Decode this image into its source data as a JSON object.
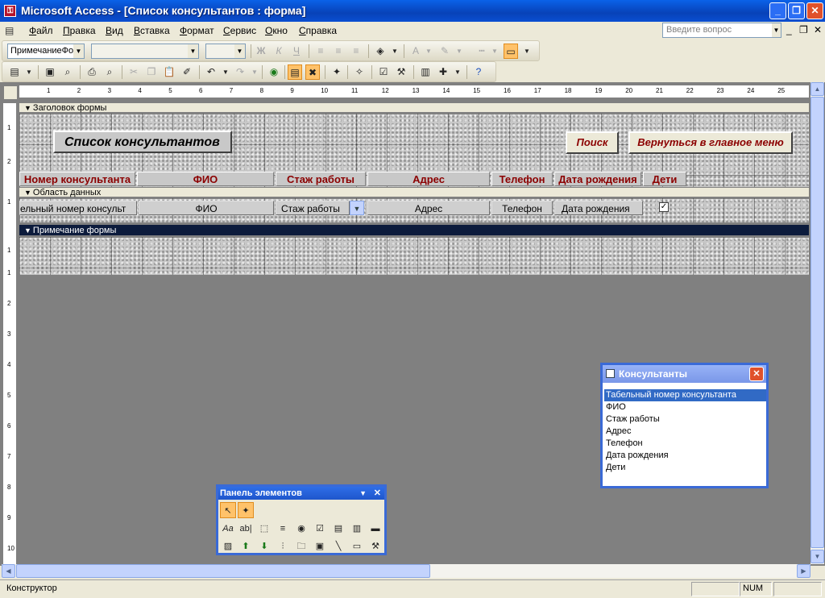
{
  "window": {
    "title": "Microsoft Access - [Список консультантов : форма]",
    "app_icon": "key-icon",
    "minimize": "_",
    "restore": "❐",
    "close": "✕"
  },
  "menu": {
    "icon": "form-icon",
    "items": [
      {
        "label": "Файл",
        "u": "Ф",
        "rest": "айл"
      },
      {
        "label": "Правка",
        "u": "П",
        "rest": "равка"
      },
      {
        "label": "Вид",
        "u": "В",
        "rest": "ид"
      },
      {
        "label": "Вставка",
        "u": "В",
        "rest": "ставка"
      },
      {
        "label": "Формат",
        "u": "Ф",
        "rest": "ормат"
      },
      {
        "label": "Сервис",
        "u": "С",
        "rest": "ервис"
      },
      {
        "label": "Окно",
        "u": "О",
        "rest": "кно"
      },
      {
        "label": "Справка",
        "u": "С",
        "rest": "правка"
      }
    ],
    "ask_placeholder": "Введите вопрос",
    "doc_minimize": "_",
    "doc_restore": "❐",
    "doc_close": "✕"
  },
  "toolbar_format": {
    "object_combo": "ПримечаниеФо",
    "font_combo": "",
    "size_combo": "",
    "bold": "Ж",
    "italic": "К",
    "underline": "Ч"
  },
  "design": {
    "sections": {
      "header": "Заголовок формы",
      "detail": "Область данных",
      "footer": "Примечание формы"
    },
    "form_title": "Список консультантов",
    "buttons": {
      "search": "Поиск",
      "back": "Вернуться в главное меню"
    },
    "column_labels": [
      "Номер консультанта",
      "ФИО",
      "Стаж работы",
      "Адрес",
      "Телефон",
      "Дата рождения",
      "Дети"
    ],
    "fields": [
      "ельный номер консульт",
      "ФИО",
      "Стаж работы",
      "Адрес",
      "Телефон",
      "Дата рождения"
    ],
    "checkbox_mark": "✓",
    "ruler_top": [
      "1",
      "2",
      "3",
      "4",
      "5",
      "6",
      "7",
      "8",
      "9",
      "10",
      "11",
      "12",
      "13",
      "14",
      "15",
      "16",
      "17",
      "18",
      "19",
      "20",
      "21",
      "22",
      "23",
      "24",
      "25"
    ],
    "ruler_left": [
      "1",
      "2",
      "1",
      "1",
      "1",
      "2",
      "3",
      "4",
      "5",
      "6",
      "7",
      "8",
      "9",
      "10"
    ]
  },
  "field_list": {
    "title": "Консультанты",
    "items": [
      "Табельный номер консультанта",
      "ФИО",
      "Стаж работы",
      "Адрес",
      "Телефон",
      "Дата рождения",
      "Дети"
    ],
    "selected": 0
  },
  "toolbox": {
    "title": "Панель элементов",
    "menu": "▼",
    "close": "✕"
  },
  "status": {
    "mode": "Конструктор",
    "num": "NUM"
  },
  "colors": {
    "title_bar": "#0a4fd2",
    "label_text": "#8b0000",
    "selected_band": "#0c1b3c",
    "selection": "#316ac5"
  }
}
